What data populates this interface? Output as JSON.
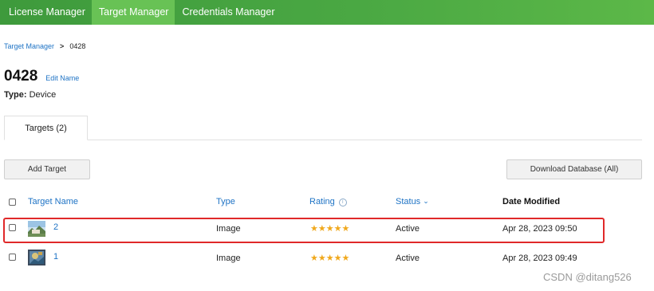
{
  "nav": {
    "items": [
      {
        "label": "License Manager",
        "active": false
      },
      {
        "label": "Target Manager",
        "active": true
      },
      {
        "label": "Credentials Manager",
        "active": false
      }
    ],
    "bg_color": "#4aa843",
    "active_color": "#68c255"
  },
  "breadcrumb": {
    "parent": "Target Manager",
    "separator": ">",
    "current": "0428"
  },
  "header": {
    "title": "0428",
    "edit_link": "Edit Name",
    "type_label": "Type:",
    "type_value": "Device"
  },
  "tabs": [
    {
      "label": "Targets (2)",
      "active": true
    }
  ],
  "toolbar": {
    "add_label": "Add Target",
    "download_label": "Download Database (All)"
  },
  "table": {
    "columns": {
      "name": "Target Name",
      "type": "Type",
      "rating": "Rating",
      "status": "Status",
      "date": "Date Modified"
    },
    "rows": [
      {
        "name": "2",
        "type": "Image",
        "rating": 5,
        "stars": "★★★★★",
        "status": "Active",
        "date": "Apr 28, 2023 09:50",
        "thumbnail": "landscape-thumbnail",
        "highlighted": true
      },
      {
        "name": "1",
        "type": "Image",
        "rating": 5,
        "stars": "★★★★★",
        "status": "Active",
        "date": "Apr 28, 2023 09:49",
        "thumbnail": "painting-thumbnail",
        "highlighted": false
      }
    ]
  },
  "colors": {
    "link": "#1e73c5",
    "star": "#f0a81c",
    "highlight_border": "#e0292a"
  },
  "watermark": "CSDN @ditang526"
}
